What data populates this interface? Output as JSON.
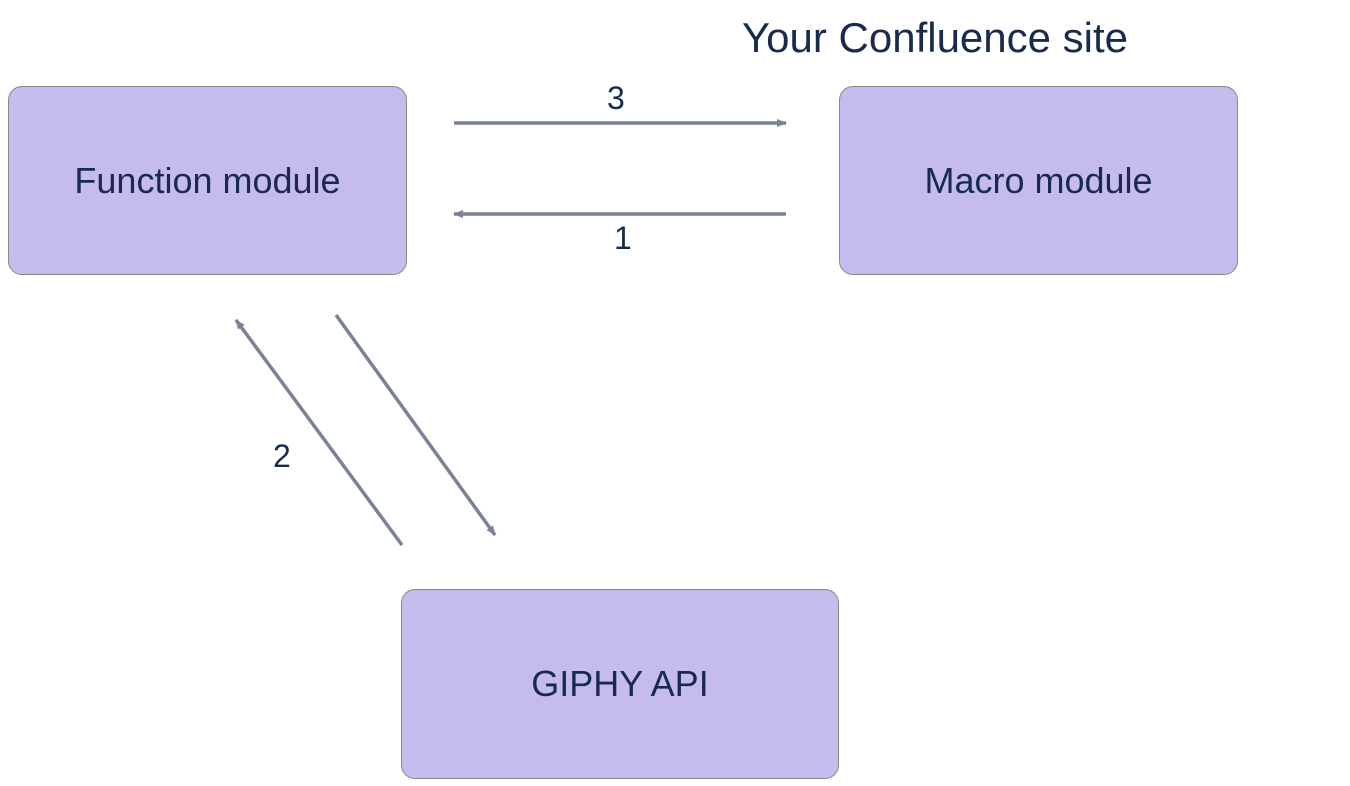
{
  "title": "Your Confluence site",
  "nodes": {
    "function_module": {
      "label": "Function module"
    },
    "macro_module": {
      "label": "Macro module"
    },
    "giphy_api": {
      "label": "GIPHY API"
    }
  },
  "edges": {
    "macro_to_function": {
      "label": "1"
    },
    "function_giphy": {
      "label": "2"
    },
    "function_to_macro": {
      "label": "3"
    }
  },
  "colors": {
    "node_bg": "#c5bced",
    "node_border": "#888888",
    "text": "#182a4d",
    "arrow": "#7a8296"
  }
}
